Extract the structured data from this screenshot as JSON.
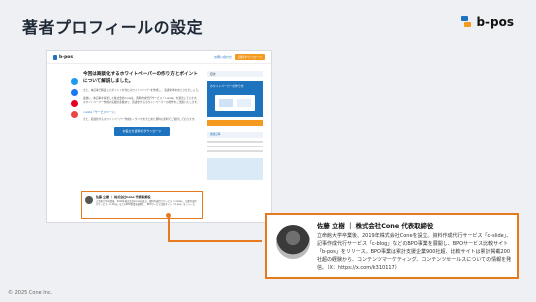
{
  "slide_title": "著者プロフィールの設定",
  "brand": {
    "name": "b-pos"
  },
  "page": {
    "logo": "b-pos",
    "nav_link": "お問い合わせ",
    "nav_button": "資料ダウンロード",
    "article_title": "今回は商談化するホワイトペーパーの作り方とポイントについて解説しました。",
    "article_p1": "また、本記事で解説したポイントを含むホワイトペーパーを作成し、 商談化率を向上させましょう。",
    "article_p2": "最後に、本記事を執筆した株式会社Coneは、資料作成代行サービス「c-slide」を運営しています。ホワイトペーパー作成の実績が多数あり、商談化するホワイトペーパーの制作をご支援いたします。",
    "article_link": "c-slide「サービスページ」",
    "article_p3": "また、商談化するホワイトペーパー作成のノウハウをまとめた資料も無料でご提供しております。",
    "cta": "お役立ち資料のダウンロード",
    "sidebar_head": "目次",
    "sidebar_banner": "ホワイトペーパーの作り方",
    "sidebar_sub": "関連記事"
  },
  "author_small": {
    "name": "佐藤 立樹 ｜ 株式会社Cone 代表取締役",
    "bio": "立命館大学卒業後、2019年株式会社Coneを設立。資料作成代行サービス「c-slide」、記事作成代行サービス「c-blog」などのBPO事業を展開し、BPOサービス比較サイト「b-pos」をリリース。"
  },
  "author_big": {
    "name": "佐藤 立樹 ｜ 株式会社Cone 代表取締役",
    "bio": "立命館大学卒業後、2019年株式会社Coneを設立。資料作成代行サービス「c-slide」、記事作成代行サービス「c-blog」などのBPO事業を展開し、BPOサービス比較サイト「b-pos」をリリース。BPO事業は累計支援企業900社超、比較サイトは累計掲載200社超の経験から、コンテンツマーケティング、コンテンツセールスについての情報を発信。（X：https://x.com/k310117）"
  },
  "footer": "© 2025 Cone Inc.",
  "colors": {
    "accent": "#e57a1f",
    "brand_blue": "#1e73be",
    "brand_orange": "#f39a1f"
  }
}
